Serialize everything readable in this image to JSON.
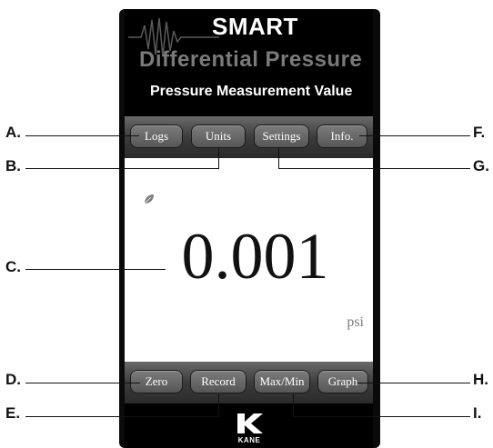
{
  "header": {
    "title_top": "SMART",
    "title_main": "Differential Pressure",
    "subtitle": "Pressure Measurement Value"
  },
  "toolbar_top": {
    "logs": "Logs",
    "units": "Units",
    "settings": "Settings",
    "info": "Info."
  },
  "reading": {
    "value": "0.001",
    "unit": "psi"
  },
  "toolbar_bottom": {
    "zero": "Zero",
    "record": "Record",
    "maxmin": "Max/Min",
    "graph": "Graph"
  },
  "brand": {
    "logo_text": "KANE"
  },
  "callouts": {
    "a": "A.",
    "b": "B.",
    "c": "C.",
    "d": "D.",
    "e": "E.",
    "f": "F.",
    "g": "G.",
    "h": "H.",
    "i": "I."
  },
  "colors": {
    "screen_bg": "#000000",
    "toolbar": "#4a4a4a",
    "title_grey": "#7a7a7a",
    "display_bg": "#ffffff"
  }
}
